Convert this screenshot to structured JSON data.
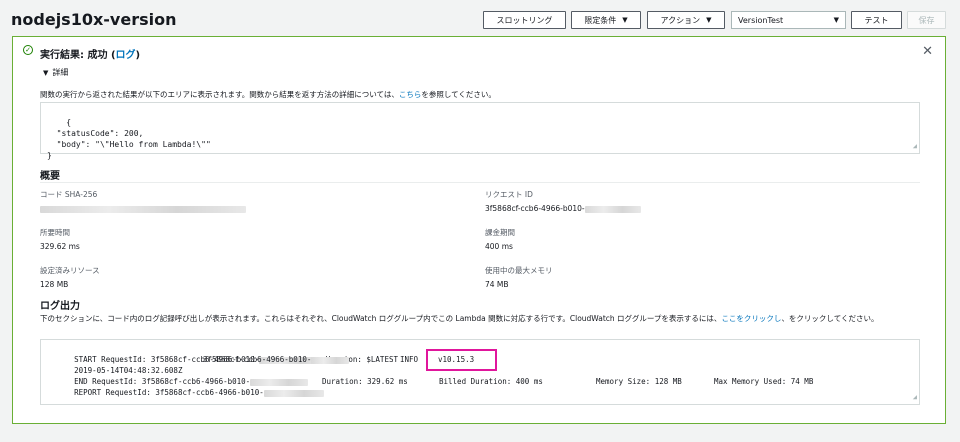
{
  "header": {
    "function_name": "nodejs10x-version",
    "throttle_label": "スロットリング",
    "qualifiers_label": "限定条件",
    "actions_label": "アクション",
    "test_event": "VersionTest",
    "test_label": "テスト",
    "save_label": "保存"
  },
  "result": {
    "title_prefix": "実行結果: 成功 (",
    "log_link": "ログ",
    "title_suffix": ")",
    "details_label": "詳細",
    "description_prefix": "関数の実行から返された結果が以下のエリアに表示されます。関数から結果を返す方法の詳細については、",
    "description_link": "こちら",
    "description_suffix": "を参照してください。",
    "output": "{\n  \"statusCode\": 200,\n  \"body\": \"\\\"Hello from Lambda!\\\"\"\n}"
  },
  "summary": {
    "heading": "概要",
    "code_sha_label": "コード SHA-256",
    "request_id_label": "リクエスト ID",
    "request_id_value": "3f5868cf-ccb6-4966-b010-",
    "duration_label": "所要時間",
    "duration_value": "329.62 ms",
    "billed_label": "課金期間",
    "billed_value": "400 ms",
    "resources_label": "設定済みリソース",
    "resources_value": "128 MB",
    "max_memory_label": "使用中の最大メモリ",
    "max_memory_value": "74 MB"
  },
  "log": {
    "heading": "ログ出力",
    "description_prefix": "下のセクションに、コード内のログ記録呼び出しが表示されます。これらはそれぞれ、CloudWatch ロググループ内でこの Lambda 関数に対応する行です。CloudWatch ロググループを表示するには、",
    "description_link": "ここをクリックし",
    "description_suffix": "、をクリックしてください。",
    "line1_start": "START RequestId: 3f5868cf-ccb6-4966-b010-",
    "line1_version": "Version: $LATEST",
    "line2_time": "2019-05-14T04:48:32.608Z",
    "line2_id": "3f5868cf-ccb6-4966-b010-",
    "line2_level": "INFO",
    "line2_message": "v10.15.3",
    "line3": "END RequestId: 3f5868cf-ccb6-4966-b010-",
    "line4_start": "REPORT RequestId: 3f5868cf-ccb6-4966-b010-",
    "line4_duration": "Duration: 329.62 ms",
    "line4_billed": "Billed Duration: 400 ms",
    "line4_memory": "Memory Size: 128 MB",
    "line4_max": "Max Memory Used: 74 MB"
  },
  "colors": {
    "success_border": "#6aaf35",
    "success_icon": "#1d8102",
    "link": "#0073bb",
    "highlight": "#e0169c"
  },
  "icons": {
    "success": "check-circle-icon",
    "close": "close-icon",
    "caret": "caret-down-icon",
    "toggle": "triangle-down-icon"
  }
}
